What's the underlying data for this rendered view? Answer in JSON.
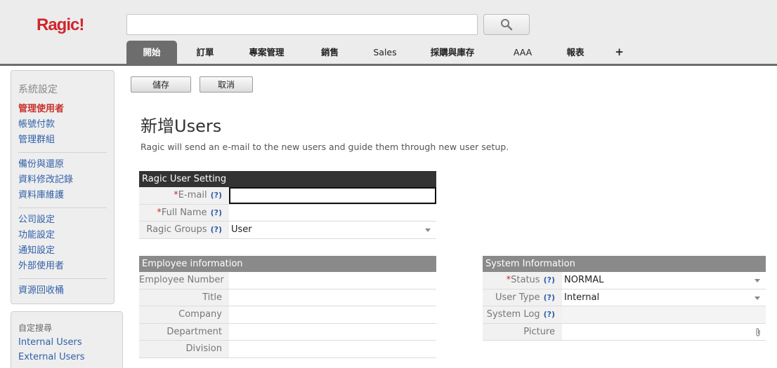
{
  "brand": {
    "logo": "Ragic!",
    "accent": "#d0262d"
  },
  "search": {
    "placeholder": ""
  },
  "tabs": [
    {
      "label": "開始"
    },
    {
      "label": "訂單"
    },
    {
      "label": "專案管理"
    },
    {
      "label": "銷售"
    },
    {
      "label": "Sales"
    },
    {
      "label": "採購與庫存"
    },
    {
      "label": "AAA"
    },
    {
      "label": "報表"
    },
    {
      "label": "+"
    }
  ],
  "sidebar": {
    "heading": "系統設定",
    "groups": [
      [
        "管理使用者",
        "帳號付款",
        "管理群組"
      ],
      [
        "備份與還原",
        "資料修改記錄",
        "資料庫維護"
      ],
      [
        "公司設定",
        "功能設定",
        "通知設定",
        "外部使用者"
      ],
      [
        "資源回收桶"
      ]
    ],
    "custom_heading": "自定搜尋",
    "custom_links": [
      "Internal Users",
      "External Users"
    ]
  },
  "toolbar": {
    "save_label": "儲存",
    "cancel_label": "取消"
  },
  "page": {
    "title": "新增Users",
    "description": "Ragic will send an e-mail to the new users and guide them through new user setup."
  },
  "user_setting": {
    "title": "Ragic User Setting",
    "email_label": "E-mail",
    "fullname_label": "Full Name",
    "groups_label": "Ragic Groups",
    "groups_value": "User",
    "help": "(?)",
    "req": "*"
  },
  "employee": {
    "title": "Employee information",
    "fields": [
      "Employee Number",
      "Title",
      "Company",
      "Department",
      "Division"
    ]
  },
  "system": {
    "title": "System Information",
    "status_label": "Status",
    "status_value": "NORMAL",
    "usertype_label": "User Type",
    "usertype_value": "Internal",
    "syslog_label": "System Log",
    "picture_label": "Picture"
  }
}
